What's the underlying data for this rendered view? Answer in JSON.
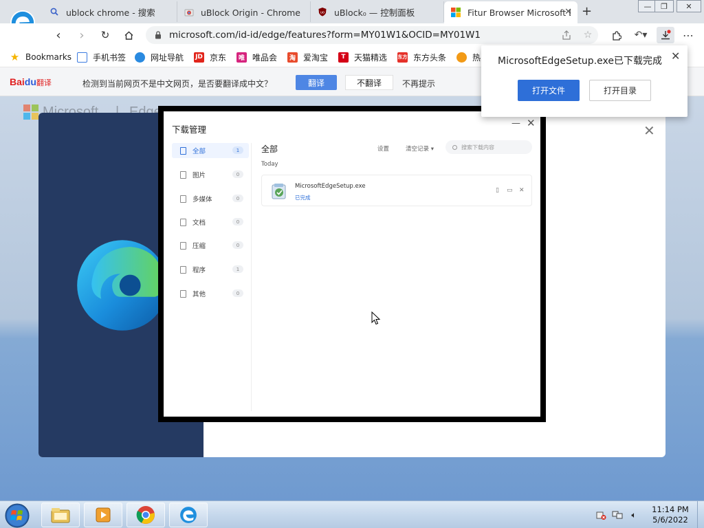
{
  "tabs": [
    {
      "label": "ublock chrome - 搜索",
      "icon": "search-icon"
    },
    {
      "label": "uBlock Origin - Chrome 网上",
      "icon": "chrome-webstore-icon"
    },
    {
      "label": "uBlock₀ — 控制面板",
      "icon": "ublock-icon"
    },
    {
      "label": "Fitur Browser Microsoft E",
      "icon": "microsoft-logo-icon",
      "active": true
    }
  ],
  "address_bar": {
    "url": "microsoft.com/id-id/edge/features?form=MY01W1&OCID=MY01W1"
  },
  "bookmarks": [
    {
      "label": "Bookmarks",
      "color": "#f5b400"
    },
    {
      "label": "手机书签",
      "color": "#3c7be0"
    },
    {
      "label": "网址导航",
      "color": "#2a8ae0"
    },
    {
      "label": "京东",
      "color": "#e1251b",
      "badge": "JD"
    },
    {
      "label": "唯品会",
      "color": "#d6247e",
      "badge": "唯"
    },
    {
      "label": "爱淘宝",
      "color": "#e84b2c",
      "badge": "淘"
    },
    {
      "label": "天猫精选",
      "color": "#d40016",
      "badge": "T"
    },
    {
      "label": "东方头条",
      "color": "#e5312a",
      "badge": "东方"
    },
    {
      "label": "热",
      "color": "#f29a16"
    }
  ],
  "translate_bar": {
    "brand_bai": "Bai",
    "brand_du": "du",
    "brand_suffix": "翻译",
    "message": "检测到当前网页不是中文网页，是否要翻译成中文？",
    "translate_label": "翻译",
    "no_translate_label": "不翻译",
    "never_label": "不再提示"
  },
  "page": {
    "brand": "Microsoft",
    "product": "Edge"
  },
  "download_manager": {
    "title": "下载管理",
    "categories": [
      {
        "label": "全部",
        "count": "1",
        "active": true
      },
      {
        "label": "图片",
        "count": "0"
      },
      {
        "label": "多媒体",
        "count": "0"
      },
      {
        "label": "文档",
        "count": "0"
      },
      {
        "label": "压缩",
        "count": "0"
      },
      {
        "label": "程序",
        "count": "1"
      },
      {
        "label": "其他",
        "count": "0"
      }
    ],
    "main_title": "全部",
    "settings_label": "设置",
    "clear_label": "清空记录",
    "search_placeholder": "搜索下载内容",
    "group_label": "Today",
    "items": [
      {
        "name": "MicrosoftEdgeSetup.exe",
        "status": "已完成"
      }
    ]
  },
  "download_popup": {
    "message": "MicrosoftEdgeSetup.exe已下载完成",
    "open_file_label": "打开文件",
    "open_dir_label": "打开目录"
  },
  "taskbar": {
    "apps": [
      "file-explorer-icon",
      "media-player-icon",
      "chrome-icon",
      "edge-icon"
    ],
    "time": "11:14 PM",
    "date": "5/6/2022"
  },
  "colors": {
    "accent": "#2e6fd8",
    "translate_accent": "#4e86e4",
    "modal_left": "#253a62"
  }
}
